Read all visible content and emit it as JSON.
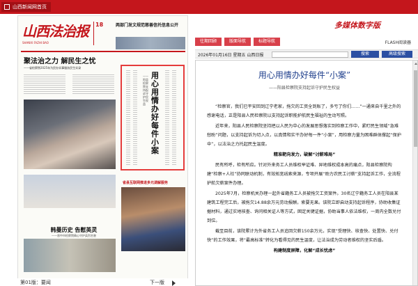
{
  "top_bar": {
    "home_label": "山西新闻网首页"
  },
  "paper": {
    "masthead": "山西法治报",
    "masthead_sub": "SHANXI FAZHI BAO",
    "issue_number": "18",
    "headline_right": "两部门发文规范慈善信托信息公开",
    "lead_title": "聚法治之力 解民生之忧",
    "lead_sub": "——省检察院2025年为民办实事服务民生实录",
    "select_title": "用心用情办好每件小案",
    "select_sub": "——阳县检察院支持起诉守护民生权益",
    "mid_red_title": "省县互联网推进多元调解服务",
    "bottom_title": "韩曼历史 告慰英灵",
    "bottom_sub": "——晋中市检察院精心守护英烈名誉",
    "page_name": "第01版：要闻",
    "next_label": "下一版"
  },
  "brand_title": "多媒体数字版",
  "nav": {
    "btn1": "往期回顾",
    "btn2": "版面导航",
    "btn3": "标题导航",
    "flash_link": "FLASH阅读器"
  },
  "info_bar": {
    "date": "2026年01月16日 星期五 山西日报",
    "search_label": "搜索",
    "advanced_label": "高级搜索"
  },
  "article": {
    "title": "用心用情办好每件“小案”",
    "subtitle": "——阳县检察院支持起诉守护民生权益",
    "p1": "“检察官，我们已平安回到辽宁老家，拖欠的工资全到账了，多亏了你们……”一通来自千里之外的感谢电话，正是阳县人民检察院以支持起诉职能护航民生福祉的生动写照。",
    "p2": "近年来，阳县人民检察院坚持把以人民为中心的发展思想落实到检察工作中，紧盯民生领域“急难愁盼”问题，以支持起诉为切入点，以真情和实干办好每一件“小案”，用检察力量为困难群体撑起“保护伞”，以法治之力托起民生温度。",
    "s1": "精准靶向发力，破解“讨薪难局”",
    "p3": "民有所呼，检有所应。针对外来务工人员维权举证难、异地维权成本高的痛点，阳县检察院构建“检察+人社”协同联动机制，有效拓宽线索来源，专项开展“助力农民工讨薪”支持起诉工作，全流程护航欠薪案件办理。",
    "p4": "2025年7月，检察机关办理一起外省籍务工人员被拖欠工资案件。30名辽宁籍务工人员在阳县某建筑工程完工后，被拖欠14.88余万元劳动报酬，索要无果。该院立即启动支持起诉程序，协助收集证据材料，通过实地核查、询问相关证人等方式，固定关键证据，协助当事人依法维权，一周内全数兑付到位。",
    "p5": "截至目前，该院累计为外省务工人员追回欠薪150余万元，实现“受理快、核查快、处置快、兑付快”的工作效果，将“最高标准”转化为看得见的民生温度，让法治成为劳动者维权的坚实后盾。",
    "s2": "构建制度屏障，化解“成长忧虑”"
  }
}
